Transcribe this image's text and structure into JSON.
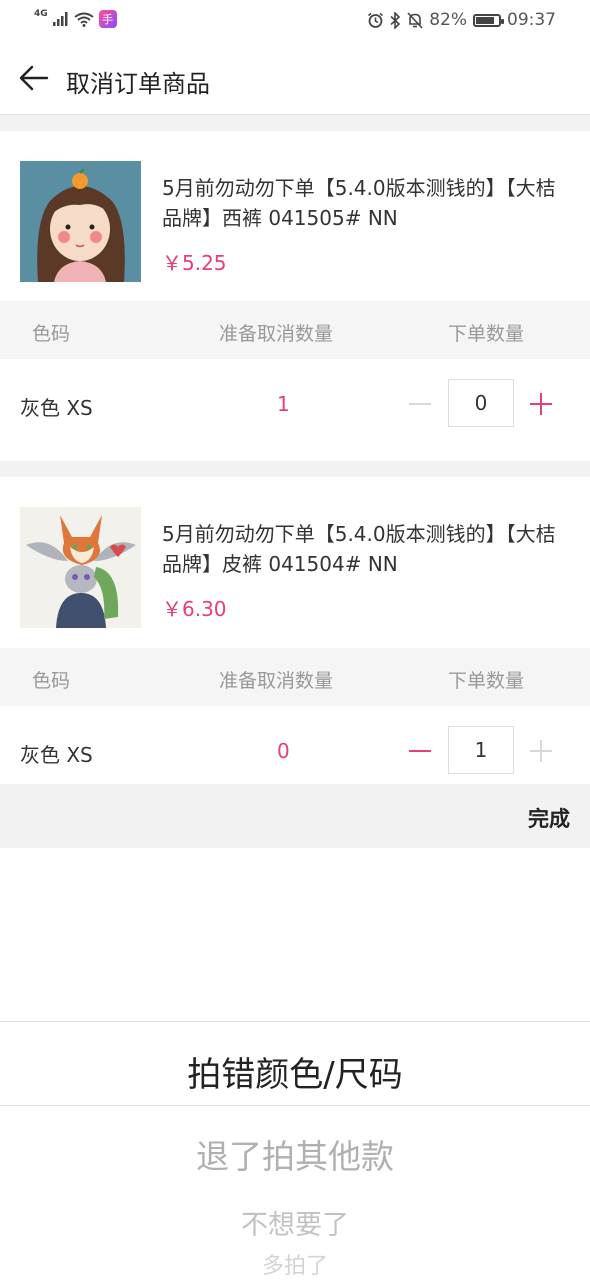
{
  "status_bar": {
    "network": "4G",
    "battery": "82%",
    "battery_level": 0.82,
    "time": "09:37",
    "icons": [
      "signal-icon",
      "wifi-icon",
      "app-icon",
      "alarm-icon",
      "bluetooth-icon",
      "mute-icon",
      "battery-icon"
    ]
  },
  "header": {
    "title": "取消订单商品"
  },
  "table_headers": {
    "color": "色码",
    "cancel_qty": "准备取消数量",
    "order_qty": "下单数量"
  },
  "products": [
    {
      "name": "5月前勿动勿下单【5.4.0版本测钱的】【大桔品牌】西裤 041505# NN",
      "price": "￥5.25",
      "sku": "灰色 XS",
      "cancel_qty": "1",
      "order_qty": "0"
    },
    {
      "name": "5月前勿动勿下单【5.4.0版本测钱的】【大桔品牌】皮裤 041504# NN",
      "price": "￥6.30",
      "sku": "灰色 XS",
      "cancel_qty": "0",
      "order_qty": "1"
    }
  ],
  "done_label": "完成",
  "picker": {
    "selected": "拍错颜色/尺码",
    "options": [
      "退了拍其他款",
      "不想要了",
      "多拍了"
    ]
  },
  "colors": {
    "accent": "#e53e7a",
    "disabled": "#d8d8d8"
  }
}
